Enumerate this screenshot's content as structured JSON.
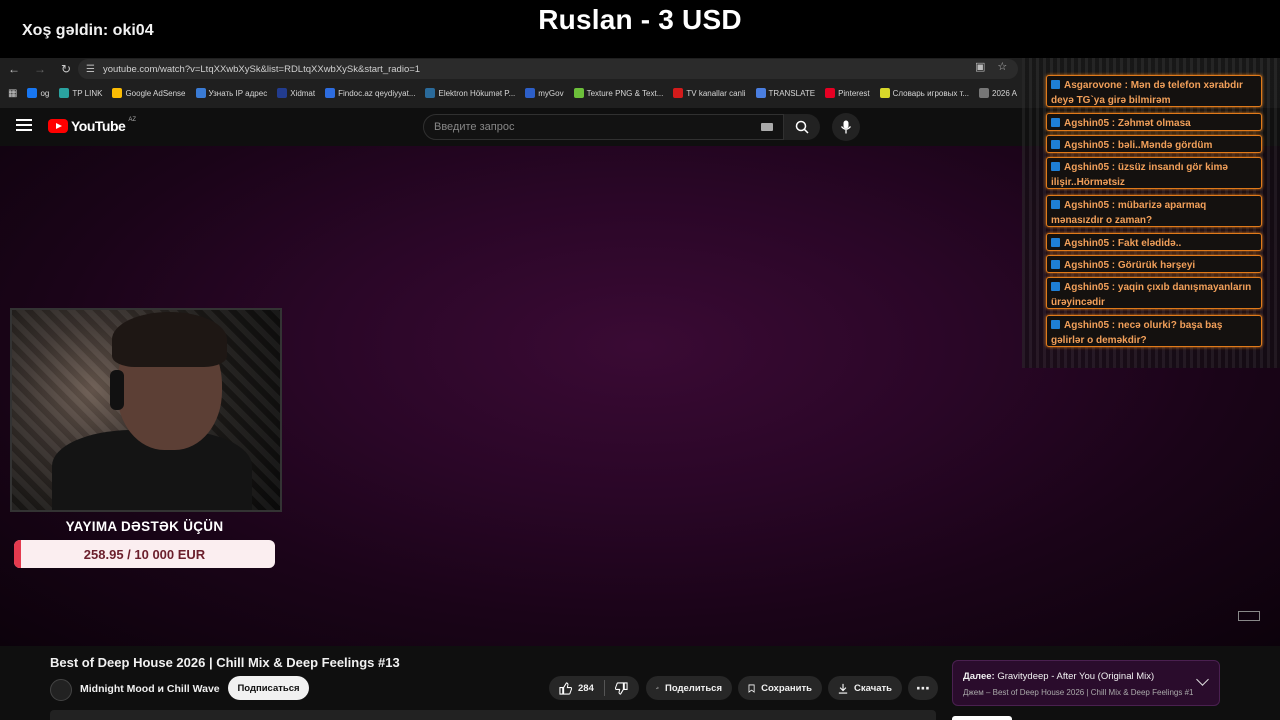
{
  "stream": {
    "welcome": "Xoş gəldin: oki04",
    "donation_headline": "Ruslan - 3 USD",
    "support_title": "YAYIMA DƏSTƏK ÜÇÜN",
    "goal_text": "258.95 / 10 000 EUR",
    "goal_progress_fraction": 0.026
  },
  "browser": {
    "url": "youtube.com/watch?v=LtqXXwbXySk&list=RDLtqXXwbXySk&start_radio=1",
    "bookmarks": [
      {
        "label": "og",
        "color": "#1877f2"
      },
      {
        "label": "TP LINK",
        "color": "#2aa3a0"
      },
      {
        "label": "Google AdSense",
        "color": "#fbbc04"
      },
      {
        "label": "Узнать IP адрес",
        "color": "#3a7bd5"
      },
      {
        "label": "Xidmat",
        "color": "#223c8f"
      },
      {
        "label": "Findoc.az qeydiyyat...",
        "color": "#2d6cdf"
      },
      {
        "label": "Elektron Hökumət P...",
        "color": "#2a6a9a"
      },
      {
        "label": "myGov",
        "color": "#2d5fc8"
      },
      {
        "label": "Texture PNG & Text...",
        "color": "#6cbf3a"
      },
      {
        "label": "TV kanallar canli",
        "color": "#d31b1b"
      },
      {
        "label": "TRANSLATE",
        "color": "#4a7ee0"
      },
      {
        "label": "Pinterest",
        "color": "#e60023"
      },
      {
        "label": "Словарь игровых т...",
        "color": "#d7d72a"
      },
      {
        "label": "2026 A",
        "color": "#777777"
      }
    ]
  },
  "youtube": {
    "logo_text": "YouTube",
    "region": "AZ",
    "search_placeholder": "Введите запрос"
  },
  "chat": [
    {
      "user": "Asgarovone",
      "text": "Mən də telefon xərabdır deyə TG`ya girə bilmirəm"
    },
    {
      "user": "Agshin05",
      "text": "Zəhmət olmasa"
    },
    {
      "user": "Agshin05",
      "text": "bəli..Məndə gördüm"
    },
    {
      "user": "Agshin05",
      "text": "üzsüz insandı gör kimə ilişir..Hörmətsiz"
    },
    {
      "user": "Agshin05",
      "text": "mübarizə aparmaq mənasızdır o zaman?"
    },
    {
      "user": "Agshin05",
      "text": "Fakt elədidə.."
    },
    {
      "user": "Agshin05",
      "text": "Görürük hərşeyi"
    },
    {
      "user": "Agshin05",
      "text": "yaqin çıxıb danışmayanların ürəyincədir"
    },
    {
      "user": "Agshin05",
      "text": "necə olurki? başa baş gəlirlər o deməkdir?"
    }
  ],
  "video": {
    "title": "Best of Deep House 2026 | Chill Mix & Deep Feelings #13",
    "channel": "Midnight Mood и Chill Wave",
    "subscribe_label": "Подписаться",
    "like_count": "284",
    "share_label": "Поделиться",
    "save_label": "Сохранить",
    "download_label": "Скачать",
    "up_next_label": "Далее:",
    "up_next_title": "Gravitydeep - After You (Original Mix)",
    "up_next_sub": "Джем – Best of Deep House 2026 | Chill Mix & Deep Feelings #13"
  },
  "colors": {
    "accent_red": "#ff0000",
    "chat_border": "#e07a1a",
    "goal_fill": "#e43a4e"
  }
}
